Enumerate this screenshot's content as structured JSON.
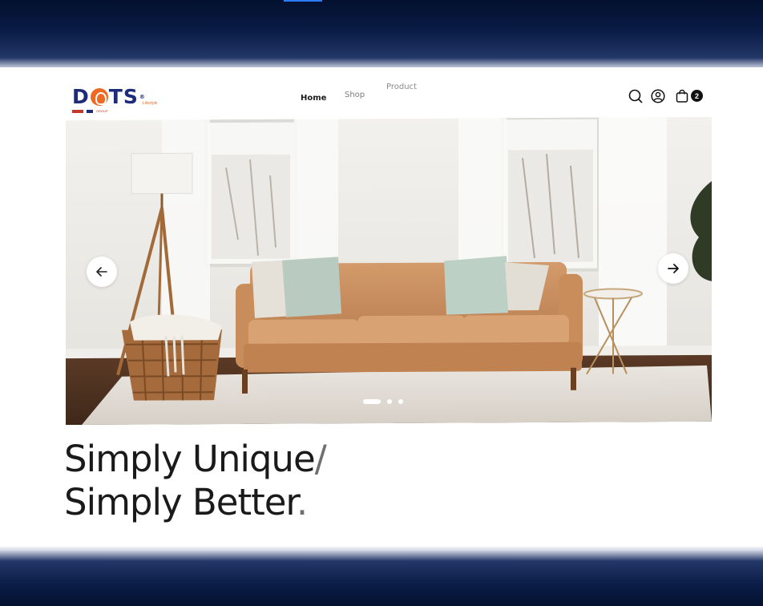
{
  "brand": {
    "name_left": "D",
    "name_right": "TS",
    "reg": "®",
    "tagline": "Lifestyle",
    "sub": "GROUP"
  },
  "nav": {
    "home": "Home",
    "shop": "Shop",
    "product": "Product"
  },
  "header_icons": {
    "search": "search-icon",
    "account": "user-icon",
    "cart": "bag-icon",
    "cart_count": "2"
  },
  "slider": {
    "prev": "arrow-left-icon",
    "next": "arrow-right-icon",
    "slide_count": 3,
    "active_slide": 1
  },
  "headline": {
    "line1": "Simply Unique",
    "line1_mark": "/",
    "line2": "Simply Better",
    "line2_mark": "."
  },
  "colors": {
    "brand_blue": "#1e2a7a",
    "brand_orange": "#ee6a22",
    "frame_navy": "#06143a",
    "text_dark": "#1a1a1a"
  }
}
